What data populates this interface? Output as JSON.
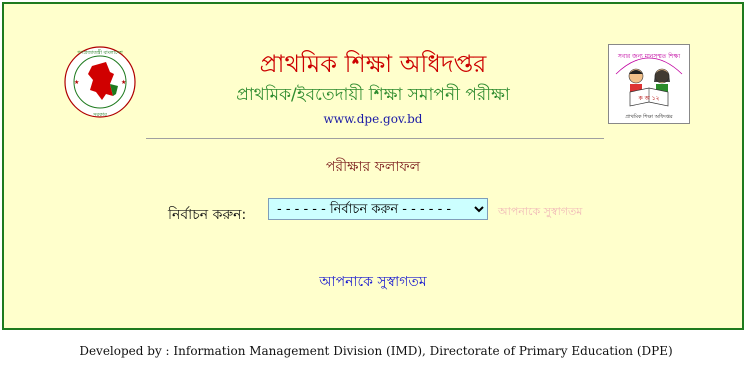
{
  "header": {
    "title": "প্রাথমিক শিক্ষা অধিদপ্তর",
    "subtitle": "প্রাথমিক/ইবতেদায়ী শিক্ষা সমাপনী পরীক্ষা",
    "website": "www.dpe.gov.bd"
  },
  "logos": {
    "left_icon": "bangladesh-govt-seal-icon",
    "left_ring_top": "গণপ্রজাতন্ত্রী বাংলাদেশ",
    "left_ring_bottom": "সরকার",
    "right_icon": "dpe-children-reading-icon",
    "right_arc_text": "সবার জন্য মানসম্মত শিক্ষা",
    "right_bottom_text": "প্রাথমিক শিক্ষা অধিদপ্তর",
    "right_book_text": "ক অ ১২"
  },
  "main": {
    "section_title": "পরীক্ষার ফলাফল",
    "select_label": "নির্বাচন করুন:",
    "select_value": "- - - - - - নির্বাচন করুন - - - - - -",
    "faded_text": "আপনাকে সুস্বাগতম",
    "welcome_link": "আপনাকে সুস্বাগতম"
  },
  "footer": {
    "text": "Developed by : Information Management Division (IMD), Directorate of Primary Education (DPE)"
  },
  "colors": {
    "background": "#ffffcc",
    "border": "#1e7a1e",
    "title": "#cc0000",
    "subtitle": "#2e8b2e",
    "select_bg": "#ccffff"
  }
}
